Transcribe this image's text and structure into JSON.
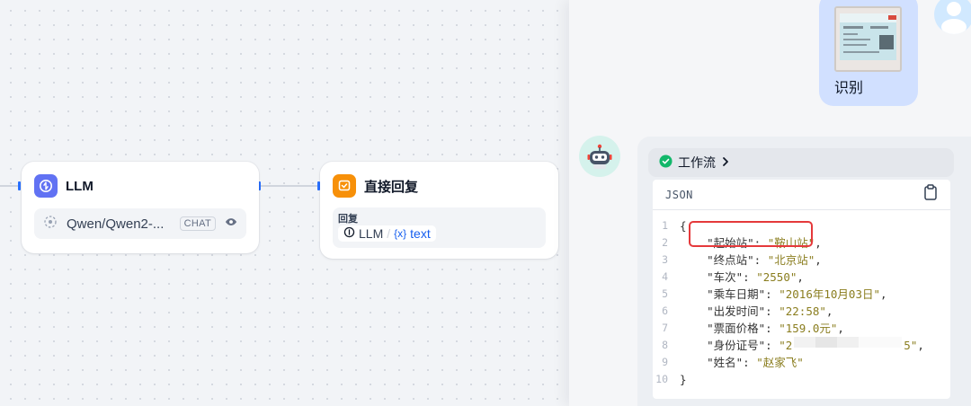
{
  "canvas": {
    "llm_node": {
      "title": "LLM",
      "model": "Qwen/Qwen2-...",
      "badge": "CHAT"
    },
    "reply_node": {
      "title": "直接回复",
      "field_label": "回复",
      "var_source": "LLM",
      "var_separator": "/",
      "var_name": "text",
      "var_prefix": "{x}"
    }
  },
  "chat": {
    "user_message": "识别",
    "workflow_label": "工作流",
    "code_lang": "JSON",
    "json_lines": [
      {
        "n": "1",
        "key": "",
        "value": "",
        "raw": "{"
      },
      {
        "n": "2",
        "key": "\"起始站\"",
        "value": "\"鞍山站\""
      },
      {
        "n": "3",
        "key": "\"终点站\"",
        "value": "\"北京站\""
      },
      {
        "n": "4",
        "key": "\"车次\"",
        "value": "\"2550\""
      },
      {
        "n": "5",
        "key": "\"乘车日期\"",
        "value": "\"2016年10月03日\""
      },
      {
        "n": "6",
        "key": "\"出发时间\"",
        "value": "\"22:58\""
      },
      {
        "n": "7",
        "key": "\"票面价格\"",
        "value": "\"159.0元\""
      },
      {
        "n": "8",
        "key": "\"身份证号\"",
        "value_start": "\"2",
        "value_end": "5\""
      },
      {
        "n": "9",
        "key": "\"姓名\"",
        "value": "\"赵家飞\""
      },
      {
        "n": "10",
        "key": "",
        "value": "",
        "raw": "}"
      }
    ]
  },
  "colors": {
    "accent": "#2970ff",
    "llm_icon": "#6172f3",
    "reply_icon": "#f79009",
    "highlight": "#e5393b",
    "success": "#12b76a"
  },
  "icons": [
    "llm-icon",
    "reply-icon",
    "model-icon",
    "eye-icon",
    "check-circle-icon",
    "chevron-right-icon",
    "copy-icon",
    "bot-avatar-icon",
    "user-avatar-icon"
  ]
}
